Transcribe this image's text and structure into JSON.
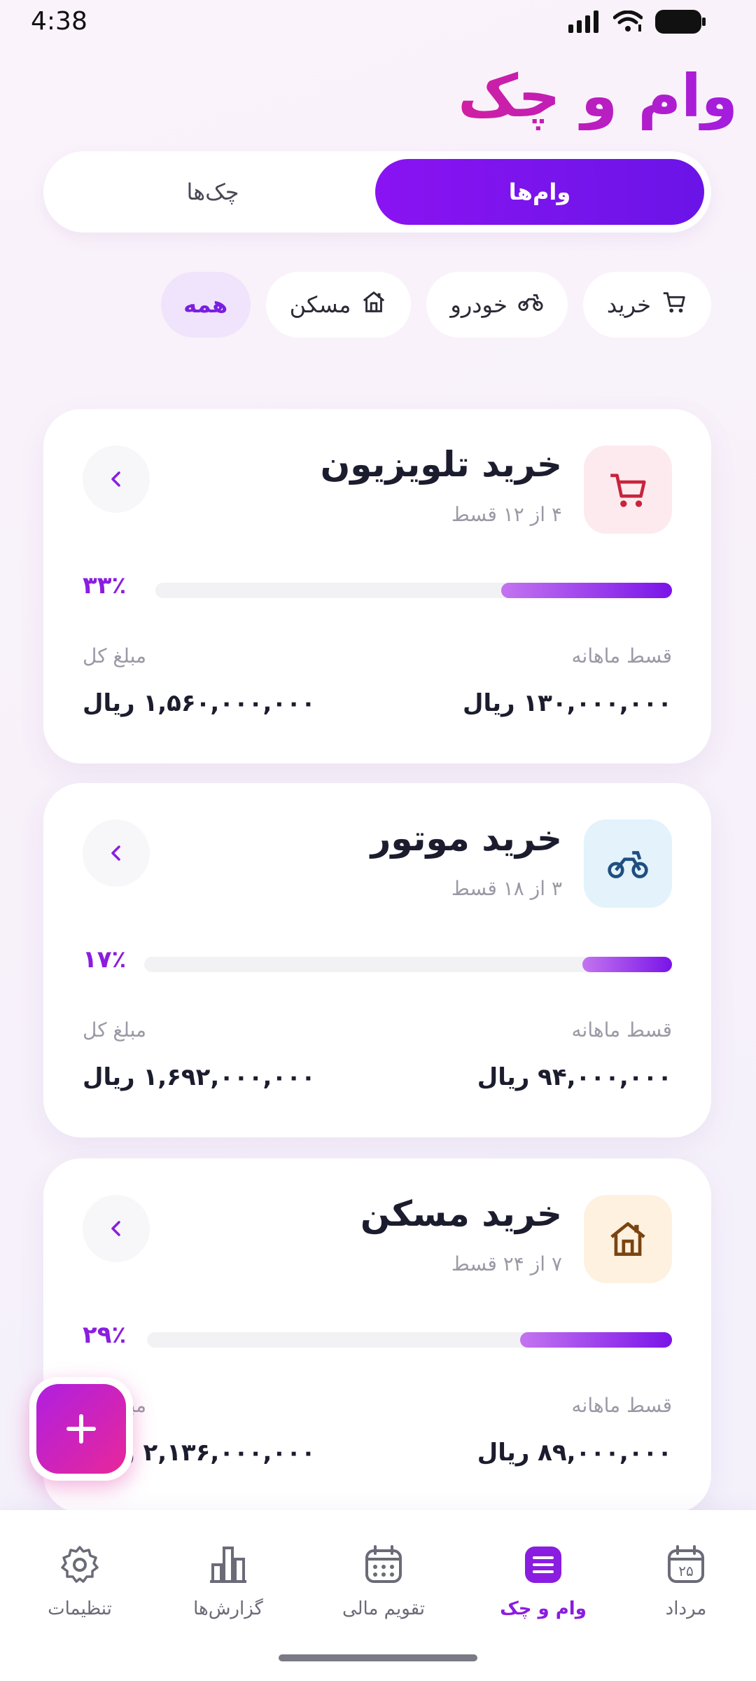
{
  "status_bar": {
    "time": "4:38"
  },
  "page": {
    "title": "وام و چک"
  },
  "tabs": [
    {
      "label": "وام‌ها",
      "active": true
    },
    {
      "label": "چک‌ها",
      "active": false
    }
  ],
  "filters": [
    {
      "label": "همه",
      "icon": "",
      "active": true
    },
    {
      "label": "مسکن",
      "icon": "house-icon",
      "active": false
    },
    {
      "label": "خودرو",
      "icon": "motorcycle-icon",
      "active": false
    },
    {
      "label": "خرید",
      "icon": "cart-icon",
      "active": false
    }
  ],
  "loans": [
    {
      "title": "خرید تلویزیون",
      "subtitle": "۴ از ۱۲ قسط",
      "icon": "cart-icon",
      "percent_label": "۳۳٪",
      "progress": 0.33,
      "monthly_label": "قسط ماهانه",
      "monthly_value": "۱۳۰,۰۰۰,۰۰۰ ریال",
      "total_label": "مبلغ کل",
      "total_value": "۱,۵۶۰,۰۰۰,۰۰۰ ریال",
      "icon_bg": "#fdeaef",
      "icon_color": "#c8243c"
    },
    {
      "title": "خرید موتور",
      "subtitle": "۳ از ۱۸ قسط",
      "icon": "motorcycle-icon",
      "percent_label": "۱۷٪",
      "progress": 0.17,
      "monthly_label": "قسط ماهانه",
      "monthly_value": "۹۴,۰۰۰,۰۰۰ ریال",
      "total_label": "مبلغ کل",
      "total_value": "۱,۶۹۲,۰۰۰,۰۰۰ ریال",
      "icon_bg": "#e3f2fb",
      "icon_color": "#1f4f80"
    },
    {
      "title": "خرید مسکن",
      "subtitle": "۷ از ۲۴ قسط",
      "icon": "house-icon",
      "percent_label": "۲۹٪",
      "progress": 0.29,
      "monthly_label": "قسط ماهانه",
      "monthly_value": "۸۹,۰۰۰,۰۰۰ ریال",
      "total_label": "مبلغ کل",
      "total_value": "۲,۱۳۶,۰۰۰,۰۰۰ ریال",
      "icon_bg": "#fef1e0",
      "icon_color": "#7a4410"
    }
  ],
  "bottom_nav": [
    {
      "label": "مرداد",
      "icon": "calendar-day-icon",
      "day": "۲۵",
      "active": false
    },
    {
      "label": "وام و چک",
      "icon": "list-icon",
      "active": true
    },
    {
      "label": "تقویم مالی",
      "icon": "calendar-icon",
      "active": false
    },
    {
      "label": "گزارش‌ها",
      "icon": "bar-chart-icon",
      "active": false
    },
    {
      "label": "تنظیمات",
      "icon": "gear-icon",
      "active": false
    }
  ],
  "colors": {
    "accent": "#8a1de0",
    "title_gradient_start": "#d11fa0",
    "fab": "#e8279a"
  }
}
